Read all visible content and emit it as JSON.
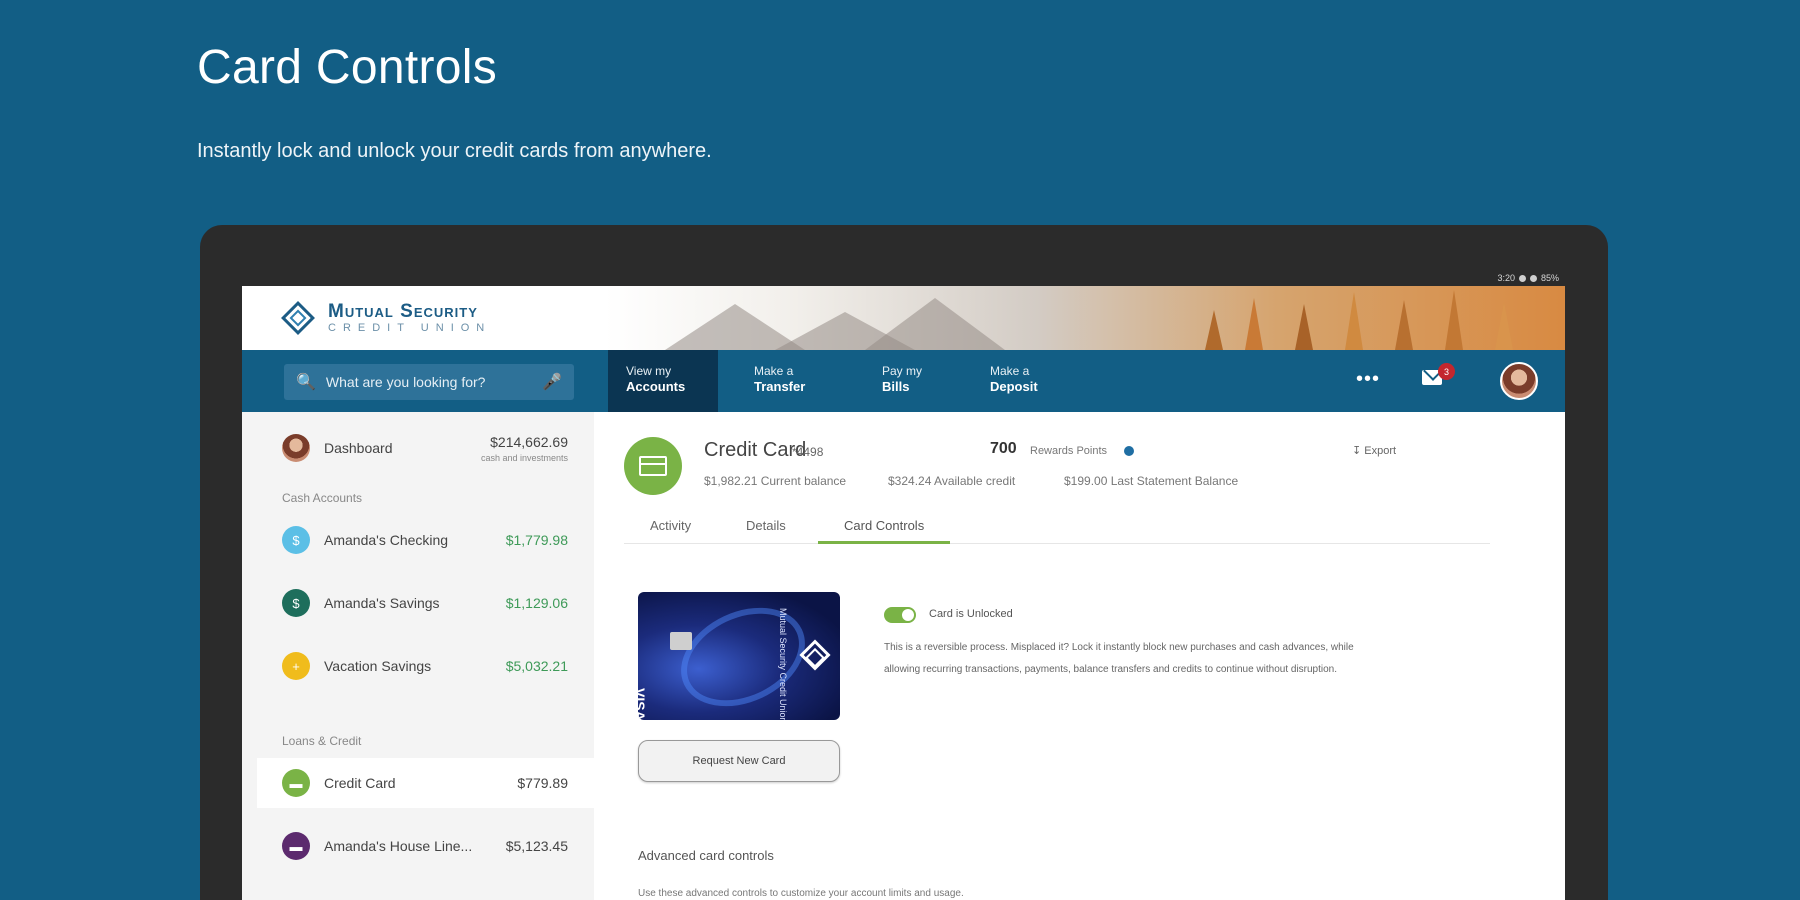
{
  "promo": {
    "title": "Card Controls",
    "subtitle": "Instantly lock and unlock your credit cards from anywhere."
  },
  "status_bar": {
    "time": "3:20",
    "battery": "85%"
  },
  "brand": {
    "name_line1": "Mutual Security",
    "name_line2": "CREDIT UNION"
  },
  "search": {
    "placeholder": "What are you looking for?"
  },
  "nav": {
    "items": [
      {
        "line1": "View my",
        "line2": "Accounts",
        "active": true
      },
      {
        "line1": "Make a",
        "line2": "Transfer",
        "active": false
      },
      {
        "line1": "Pay my",
        "line2": "Bills",
        "active": false
      },
      {
        "line1": "Make a",
        "line2": "Deposit",
        "active": false
      }
    ],
    "more_label": "•••",
    "mail_badge": "3"
  },
  "sidebar": {
    "dashboard": {
      "label": "Dashboard",
      "value": "$214,662.69",
      "sub": "cash and investments"
    },
    "cash_section": "Cash Accounts",
    "cash_accounts": [
      {
        "label": "Amanda's Checking",
        "value": "$1,779.98",
        "color": "#5bbfe6",
        "icon": "$"
      },
      {
        "label": "Amanda's Savings",
        "value": "$1,129.06",
        "color": "#1e6e5c",
        "icon": "$"
      },
      {
        "label": "Vacation Savings",
        "value": "$5,032.21",
        "color": "#f0bc1c",
        "icon": "+"
      }
    ],
    "loans_section": "Loans & Credit",
    "loans": [
      {
        "label": "Credit Card",
        "value": "$779.89",
        "color": "#7ab346"
      },
      {
        "label": "Amanda's House Line...",
        "value": "$5,123.45",
        "color": "#5c2a6e"
      }
    ]
  },
  "account": {
    "title": "Credit Card",
    "number": "*4498",
    "points": "700",
    "points_label": "Rewards Points",
    "export_label": "Export",
    "current_balance": "$1,982.21 Current balance",
    "available_credit": "$324.24 Available credit",
    "last_statement": "$199.00 Last Statement Balance"
  },
  "tabs": [
    {
      "label": "Activity"
    },
    {
      "label": "Details"
    },
    {
      "label": "Card Controls"
    }
  ],
  "card_controls": {
    "toggle_label": "Card is Unlocked",
    "description": "This is a reversible process. Misplaced it? Lock it instantly block new purchases and cash advances, while allowing recurring transactions, payments, balance transfers and credits to continue without disruption.",
    "request_button": "Request New Card",
    "card_brand": "Mutual Security Credit Union",
    "card_network": "VISA",
    "advanced_title": "Advanced card controls",
    "advanced_desc": "Use these advanced controls to customize your account limits and usage."
  },
  "colors": {
    "brand_blue": "#125e85",
    "nav_active": "#0b3552",
    "accent_green": "#7ab346"
  }
}
